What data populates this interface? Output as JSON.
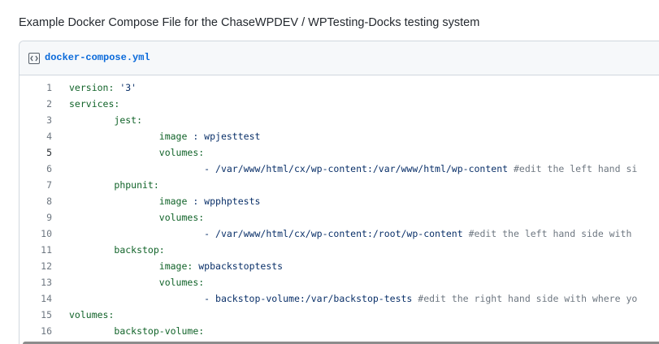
{
  "page": {
    "heading": "Example Docker Compose File for the ChaseWPDEV / WPTesting-Docks testing system"
  },
  "file": {
    "icon": "code-square-icon",
    "name": "docker-compose.yml"
  },
  "code": {
    "lines": [
      {
        "num": "1",
        "indent": "",
        "key": "version:",
        "value": " '3'",
        "comment": ""
      },
      {
        "num": "2",
        "indent": "",
        "key": "services:",
        "value": "",
        "comment": ""
      },
      {
        "num": "3",
        "indent": "        ",
        "key": "jest:",
        "value": "",
        "comment": ""
      },
      {
        "num": "4",
        "indent": "                ",
        "key": "image",
        "value": " : wpjesttest",
        "comment": ""
      },
      {
        "num": "5",
        "indent": "                ",
        "key": "volumes:",
        "value": "",
        "comment": ""
      },
      {
        "num": "6",
        "indent": "                        ",
        "key": "",
        "value": "- /var/www/html/cx/wp-content:/var/www/html/wp-content ",
        "comment": "#edit the left hand si"
      },
      {
        "num": "7",
        "indent": "        ",
        "key": "phpunit:",
        "value": "",
        "comment": ""
      },
      {
        "num": "8",
        "indent": "                ",
        "key": "image",
        "value": " : wpphptests",
        "comment": ""
      },
      {
        "num": "9",
        "indent": "                ",
        "key": "volumes:",
        "value": "",
        "comment": ""
      },
      {
        "num": "10",
        "indent": "                        ",
        "key": "",
        "value": "- /var/www/html/cx/wp-content:/root/wp-content ",
        "comment": "#edit the left hand side with"
      },
      {
        "num": "11",
        "indent": "        ",
        "key": "backstop:",
        "value": "",
        "comment": ""
      },
      {
        "num": "12",
        "indent": "                ",
        "key": "image:",
        "value": " wpbackstoptests",
        "comment": ""
      },
      {
        "num": "13",
        "indent": "                ",
        "key": "volumes:",
        "value": "",
        "comment": ""
      },
      {
        "num": "14",
        "indent": "                        ",
        "key": "",
        "value": "- backstop-volume:/var/backstop-tests ",
        "comment": "#edit the right hand side with where yo"
      },
      {
        "num": "15",
        "indent": "",
        "key": "volumes:",
        "value": "",
        "comment": ""
      },
      {
        "num": "16",
        "indent": "        ",
        "key": "backstop-volume:",
        "value": "",
        "comment": ""
      }
    ],
    "active_line": "5"
  },
  "colors": {
    "key": "#116329",
    "value": "#0a3069",
    "comment": "#6e7781",
    "file_link": "#0969da"
  }
}
